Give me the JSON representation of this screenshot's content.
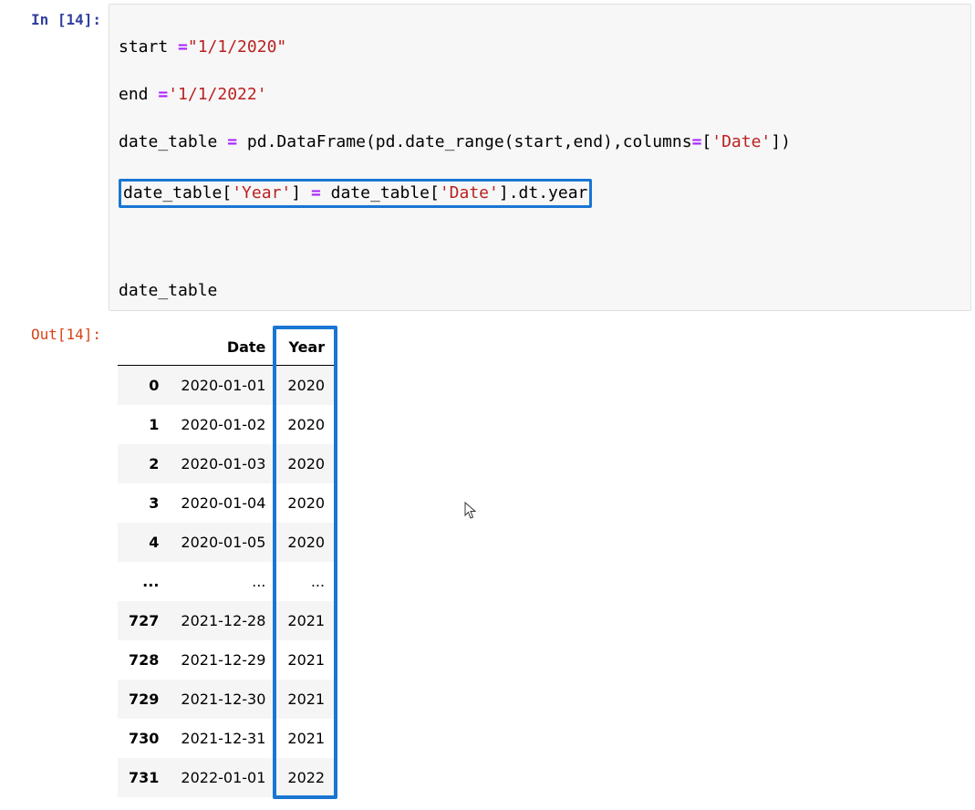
{
  "input_prompt": "In [14]:",
  "output_prompt": "Out[14]:",
  "code": {
    "l1_a": "start ",
    "l1_eq": "=",
    "l1_s": "\"1/1/2020\"",
    "l2_a": "end ",
    "l2_eq": "=",
    "l2_s": "'1/1/2022'",
    "l3": "date_table = pd.DataFrame(pd.date_range(start,end),columns=['Date'])",
    "l3_a": "date_table ",
    "l3_eq": "=",
    "l3_b": " pd.DataFrame(pd.date_range(start,end),columns",
    "l3_eq2": "=",
    "l3_c": "[",
    "l3_s": "'Date'",
    "l3_d": "])",
    "l4_a": "date_table[",
    "l4_s1": "'Year'",
    "l4_b": "] ",
    "l4_eq": "=",
    "l4_c": " date_table[",
    "l4_s2": "'Date'",
    "l4_d": "].dt.year",
    "l6": "date_table"
  },
  "table": {
    "headers": [
      "Date",
      "Year"
    ],
    "rows": [
      {
        "idx": "0",
        "date": "2020-01-01",
        "year": "2020"
      },
      {
        "idx": "1",
        "date": "2020-01-02",
        "year": "2020"
      },
      {
        "idx": "2",
        "date": "2020-01-03",
        "year": "2020"
      },
      {
        "idx": "3",
        "date": "2020-01-04",
        "year": "2020"
      },
      {
        "idx": "4",
        "date": "2020-01-05",
        "year": "2020"
      },
      {
        "idx": "...",
        "date": "...",
        "year": "..."
      },
      {
        "idx": "727",
        "date": "2021-12-28",
        "year": "2021"
      },
      {
        "idx": "728",
        "date": "2021-12-29",
        "year": "2021"
      },
      {
        "idx": "729",
        "date": "2021-12-30",
        "year": "2021"
      },
      {
        "idx": "730",
        "date": "2021-12-31",
        "year": "2021"
      },
      {
        "idx": "731",
        "date": "2022-01-01",
        "year": "2022"
      }
    ]
  },
  "highlight_color": "#1976D2"
}
